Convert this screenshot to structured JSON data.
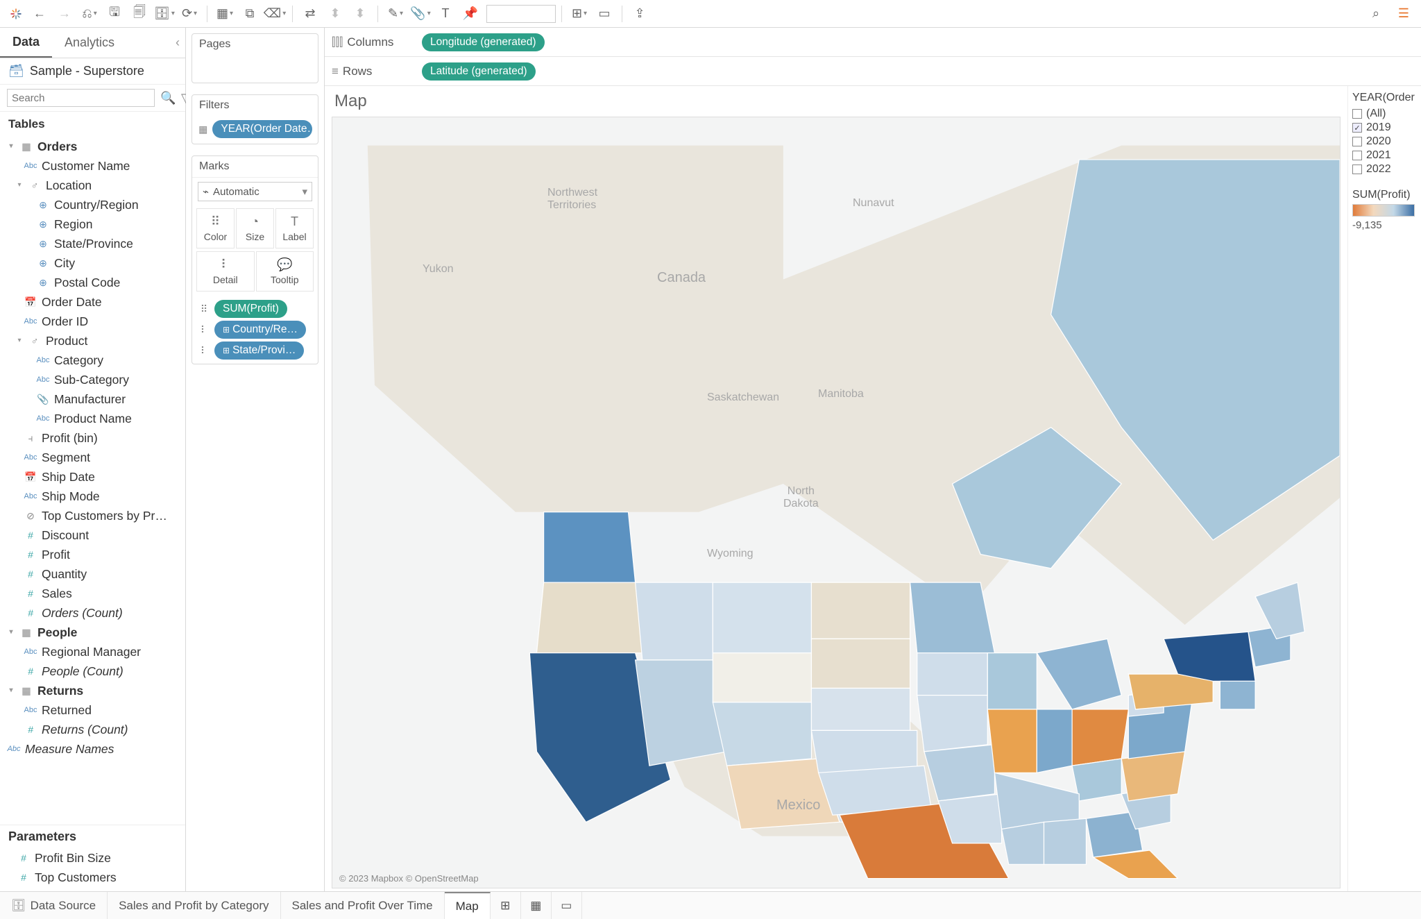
{
  "toolbar": {
    "search_placeholder": ""
  },
  "dataPane": {
    "tabs": {
      "data": "Data",
      "analytics": "Analytics"
    },
    "datasource": "Sample - Superstore",
    "search_placeholder": "Search",
    "tablesHeader": "Tables",
    "tables": {
      "orders": "Orders",
      "fields": {
        "customer_name": "Customer Name",
        "location": "Location",
        "country_region": "Country/Region",
        "region": "Region",
        "state_province": "State/Province",
        "city": "City",
        "postal_code": "Postal Code",
        "order_date": "Order Date",
        "order_id": "Order ID",
        "product": "Product",
        "category": "Category",
        "sub_category": "Sub-Category",
        "manufacturer": "Manufacturer",
        "product_name": "Product Name",
        "profit_bin": "Profit (bin)",
        "segment": "Segment",
        "ship_date": "Ship Date",
        "ship_mode": "Ship Mode",
        "top_customers": "Top Customers by Pr…",
        "discount": "Discount",
        "profit": "Profit",
        "quantity": "Quantity",
        "sales": "Sales",
        "orders_count": "Orders (Count)"
      },
      "people": "People",
      "people_fields": {
        "regional_manager": "Regional Manager",
        "people_count": "People (Count)"
      },
      "returns": "Returns",
      "returns_fields": {
        "returned": "Returned",
        "returns_count": "Returns (Count)"
      },
      "measure_names": "Measure Names"
    },
    "paramsHeader": "Parameters",
    "params": {
      "profit_bin_size": "Profit Bin Size",
      "top_customers": "Top Customers"
    }
  },
  "shelves": {
    "pages": "Pages",
    "filters": "Filters",
    "filter_pill": "YEAR(Order Date…",
    "marks": "Marks",
    "mark_type": "Automatic",
    "cells": {
      "color": "Color",
      "size": "Size",
      "label": "Label",
      "detail": "Detail",
      "tooltip": "Tooltip"
    },
    "mark_pills": {
      "sum_profit": "SUM(Profit)",
      "country": "Country/Re…",
      "state": "State/Provi…"
    }
  },
  "crShelves": {
    "columns": "Columns",
    "rows": "Rows",
    "col_pill": "Longitude (generated)",
    "row_pill": "Latitude (generated)"
  },
  "view": {
    "title": "Map",
    "credit": "© 2023 Mapbox © OpenStreetMap",
    "bg_labels": {
      "nwt": "Northwest\nTerritories",
      "yukon": "Yukon",
      "nunavut": "Nunavut",
      "sask": "Saskatchewan",
      "manitoba": "Manitoba",
      "canada": "Canada",
      "ndakota": "North\nDakota",
      "wyoming": "Wyoming",
      "mexico": "Mexico"
    }
  },
  "legend": {
    "title": "YEAR(Order",
    "years": {
      "all": "(All)",
      "y2019": "2019",
      "y2020": "2020",
      "y2021": "2021",
      "y2022": "2022"
    },
    "sum_label": "SUM(Profit)",
    "min_val": "-9,135"
  },
  "bottomTabs": {
    "datasource": "Data Source",
    "tab1": "Sales and Profit by Category",
    "tab2": "Sales and Profit Over Time",
    "tab3": "Map"
  },
  "chart_data": {
    "type": "map",
    "title": "Map",
    "color_field": "SUM(Profit)",
    "filter": {
      "field": "YEAR(Order Date)",
      "selected": [
        2019
      ],
      "options": [
        "(All)",
        2019,
        2020,
        2021,
        2022
      ]
    },
    "legend": {
      "min": -9135,
      "gradient": [
        "#e07b3a",
        "#f3d8bc",
        "#c3d8e7",
        "#3c6fa5"
      ]
    },
    "geo_fields": [
      "Country/Region",
      "State/Province"
    ],
    "notes": "Choropleth of SUM(Profit) by US state for 2019; orange=negative, blue=positive. Individual state values not labeled on map."
  }
}
